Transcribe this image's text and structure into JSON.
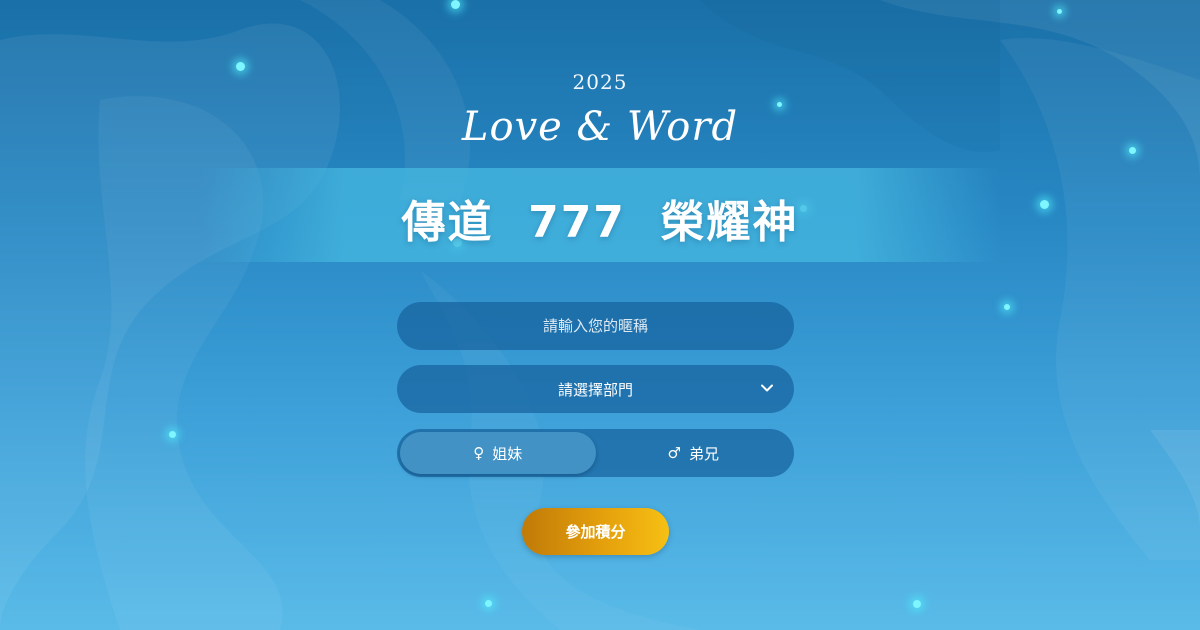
{
  "header": {
    "year": "2025",
    "script_title": "Love & Word",
    "main_title": "傳道  777  榮耀神"
  },
  "form": {
    "nickname": {
      "placeholder": "請輸入您的暱稱",
      "value": ""
    },
    "department": {
      "selected_label": "請選擇部門",
      "icon": "chevron-down-icon"
    },
    "gender": {
      "options": [
        {
          "symbol": "♀",
          "label": "姐妹",
          "icon": "female-icon",
          "selected": true
        },
        {
          "symbol": "♂",
          "label": "弟兄",
          "icon": "male-icon",
          "selected": false
        }
      ]
    },
    "submit_label": "參加積分"
  },
  "theme": {
    "background_top": "#1a70a8",
    "background_bottom": "#5abbe8",
    "field_background": "#16629e",
    "button_gradient_start": "#c07a08",
    "button_gradient_end": "#f6c014",
    "particle_color": "#7ff5ff"
  }
}
